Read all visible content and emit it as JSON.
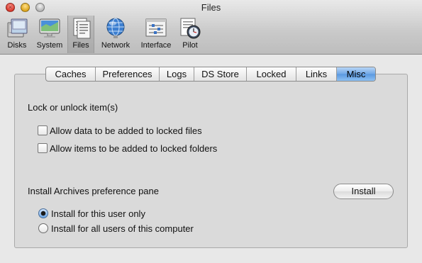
{
  "window": {
    "title": "Files"
  },
  "toolbar": {
    "items": [
      {
        "label": "Disks",
        "icon": "disks-icon"
      },
      {
        "label": "System",
        "icon": "system-icon"
      },
      {
        "label": "Files",
        "icon": "files-icon",
        "selected": true
      },
      {
        "label": "Network",
        "icon": "network-icon"
      },
      {
        "label": "Interface",
        "icon": "interface-icon"
      },
      {
        "label": "Pilot",
        "icon": "pilot-icon"
      }
    ]
  },
  "tabs": [
    "Caches",
    "Preferences",
    "Logs",
    "DS Store",
    "Locked",
    "Links",
    "Misc"
  ],
  "active_tab": "Misc",
  "lock": {
    "heading": "Lock or unlock item(s)",
    "options": [
      {
        "label": "Allow data to be added to locked files",
        "checked": false
      },
      {
        "label": "Allow items to be added to locked folders",
        "checked": false
      }
    ]
  },
  "install": {
    "heading": "Install Archives preference pane",
    "button_label": "Install",
    "options": [
      {
        "label": "Install for this user only",
        "selected": true
      },
      {
        "label": "Install for all users of this computer",
        "selected": false
      }
    ]
  },
  "colors": {
    "accent": "#5a98e0",
    "background": "#e8e8e8",
    "panel": "#dadada"
  }
}
